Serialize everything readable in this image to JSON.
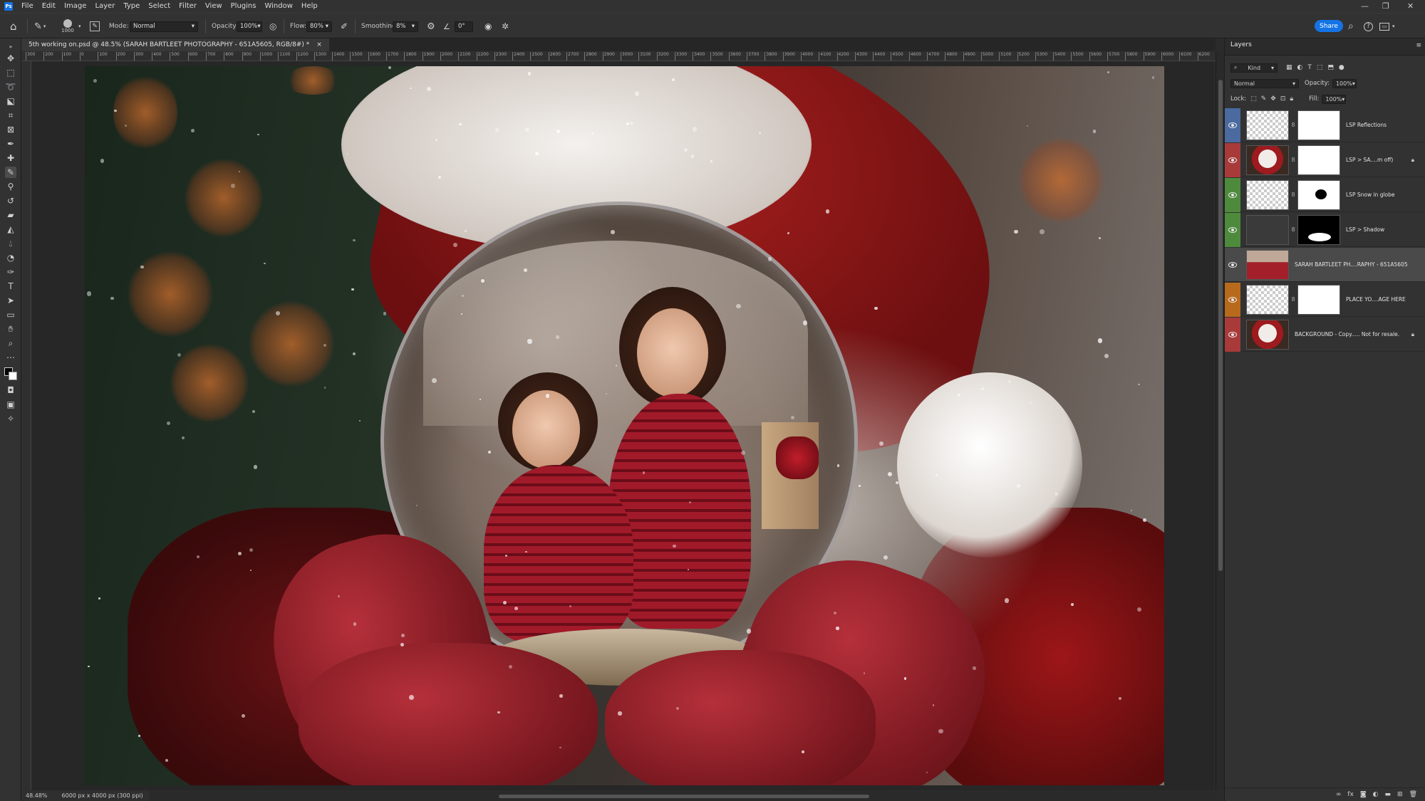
{
  "colors": {
    "accent": "#1473e6",
    "tag_blue": "#4a6aa0",
    "tag_red": "#a83a3a",
    "tag_green": "#4e8a3c",
    "tag_orange": "#b86a1c"
  },
  "menu": [
    "File",
    "Edit",
    "Image",
    "Layer",
    "Type",
    "Select",
    "Filter",
    "View",
    "Plugins",
    "Window",
    "Help"
  ],
  "options": {
    "brush_size": "1000",
    "mode_label": "Mode:",
    "mode_value": "Normal",
    "opacity_label": "Opacity:",
    "opacity_value": "100%",
    "flow_label": "Flow:",
    "flow_value": "80%",
    "smoothing_label": "Smoothing:",
    "smoothing_value": "8%",
    "angle_value": "0°",
    "share_label": "Share"
  },
  "document": {
    "tab_title": "5th working on.psd @ 48.5% (SARAH BARTLEET PHOTOGRAPHY - 651A5605, RGB/8#) *",
    "close_glyph": "×"
  },
  "ruler_top": [
    "300",
    "200",
    "100",
    "0",
    "100",
    "200",
    "300",
    "400",
    "500",
    "600",
    "700",
    "800",
    "900",
    "1000",
    "1100",
    "1200",
    "1300",
    "1400",
    "1500",
    "1600",
    "1700",
    "1800",
    "1900",
    "2000",
    "2100",
    "2200",
    "2300",
    "2400",
    "2500",
    "2600",
    "2700",
    "2800",
    "2900",
    "3000",
    "3100",
    "3200",
    "3300",
    "3400",
    "3500",
    "3600",
    "3700",
    "3800",
    "3900",
    "4000",
    "4100",
    "4200",
    "4300",
    "4400",
    "4500",
    "4600",
    "4700",
    "4800",
    "4900",
    "5000",
    "5100",
    "5200",
    "5300",
    "5400",
    "5500",
    "5600",
    "5700",
    "5800",
    "5900",
    "6000",
    "6100",
    "6200"
  ],
  "status": {
    "zoom": "48.48%",
    "doc_size": "6000 px x 4000 px (300 ppi)"
  },
  "layers_panel": {
    "title": "Layers",
    "kind_label": "Kind",
    "blend_mode": "Normal",
    "opacity_label": "Opacity:",
    "opacity_value": "100%",
    "lock_label": "Lock:",
    "fill_label": "Fill:",
    "fill_value": "100%",
    "layers": [
      {
        "name": "LSP Reflections",
        "tag": "#4a6aa0",
        "locked": false,
        "selected": false
      },
      {
        "name": "LSP > SA....m off)",
        "tag": "#a83a3a",
        "locked": true,
        "selected": false
      },
      {
        "name": "LSP Snow in globe",
        "tag": "#4e8a3c",
        "locked": false,
        "selected": false
      },
      {
        "name": "LSP > Shadow",
        "tag": "#4e8a3c",
        "locked": false,
        "selected": false
      },
      {
        "name": "SARAH BARTLEET PH....RAPHY - 651A5605",
        "tag": "",
        "locked": false,
        "selected": true
      },
      {
        "name": "PLACE YO....AGE HERE",
        "tag": "#b86a1c",
        "locked": false,
        "selected": false
      },
      {
        "name": "BACKGROUND - Copy..... Not for resale.",
        "tag": "#a83a3a",
        "locked": true,
        "selected": false
      }
    ]
  },
  "icons": {
    "home": "⌂",
    "brush": "✎",
    "gear": "⚙",
    "bell": "🔔",
    "search": "⌕",
    "help": "?",
    "lock": "🔒",
    "link": "∞",
    "chain": "8"
  }
}
